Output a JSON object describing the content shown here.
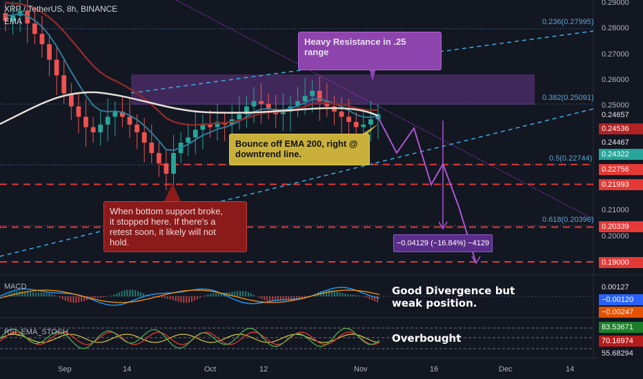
{
  "header": {
    "symbol": "XRP / TetherUS, 8h, BINANCE",
    "indicator": "EMA"
  },
  "annotations": {
    "resistance": [
      "Heavy Resistance in .25",
      "range"
    ],
    "bounce": [
      "Bounce off EMA 200, right @",
      "downtrend line."
    ],
    "support": [
      "When bottom support broke,",
      "it stopped here. If there's a",
      "retest soon, it likely will not",
      "hold."
    ],
    "measure": "−0.04129 (−16.84%) −4129",
    "macd_note": [
      "Good Divergence but",
      "weak position."
    ],
    "rsi_note": "Overbought"
  },
  "fib_levels": {
    "f236": "0.236(0.27995)",
    "f382": "0.382(0.25091)",
    "f5": "0.5(0.22744)",
    "f618": "0.618(0.20396)"
  },
  "price_axis": {
    "ticks": [
      "0.29000",
      "0.28000",
      "0.27000",
      "0.26000",
      "0.25000",
      "0.21000",
      "0.20000"
    ],
    "tags": {
      "t1": "0.24657",
      "t2": "0.24536",
      "t3": "0.24467",
      "t4": "0.24322",
      "t5": "0.22756",
      "t6": "0.21993",
      "t7": "0.20339",
      "t8": "0.19000"
    }
  },
  "indicators": {
    "macd_title": "MACD",
    "macd_tags": [
      "0.00127",
      "−0.00120",
      "−0.00247"
    ],
    "rsi_title": "RSI_EMA_STOCH",
    "rsi_tags": [
      "83.53671",
      "70.16974",
      "55.68294"
    ]
  },
  "time_axis": [
    "Sep",
    "14",
    "Oct",
    "12",
    "Nov",
    "16",
    "Dec",
    "14"
  ],
  "colors": {
    "up": "#26a69a",
    "down": "#ef5350",
    "ema_fast": "#2e7d9a",
    "ema_mid": "#8b2a2a",
    "ema_200": "#e8e0d8",
    "fib": "#5aa5d6",
    "support": "#e53935",
    "projection": "#b055d6"
  },
  "chart_data": {
    "type": "candlestick",
    "symbol": "XRP / TetherUS",
    "interval": "8h",
    "exchange": "BINANCE",
    "price_range": [
      0.19,
      0.29
    ],
    "close_approx": [
      0.283,
      0.285,
      0.287,
      0.282,
      0.278,
      0.274,
      0.268,
      0.262,
      0.255,
      0.25,
      0.246,
      0.242,
      0.24,
      0.243,
      0.246,
      0.248,
      0.246,
      0.243,
      0.24,
      0.236,
      0.232,
      0.228,
      0.224,
      0.232,
      0.236,
      0.238,
      0.241,
      0.243,
      0.242,
      0.244,
      0.243,
      0.245,
      0.247,
      0.25,
      0.252,
      0.251,
      0.249,
      0.247,
      0.248,
      0.25,
      0.252,
      0.254,
      0.256,
      0.252,
      0.25,
      0.248,
      0.246,
      0.244,
      0.242,
      0.243,
      0.245,
      0.247
    ],
    "horizontal_levels": [
      0.22756,
      0.21993,
      0.20339,
      0.19
    ],
    "fib_levels": {
      "0.236": 0.27995,
      "0.382": 0.25091,
      "0.5": 0.22744,
      "0.618": 0.20396
    },
    "projection_change": {
      "abs": -0.04129,
      "pct": -16.84
    }
  }
}
